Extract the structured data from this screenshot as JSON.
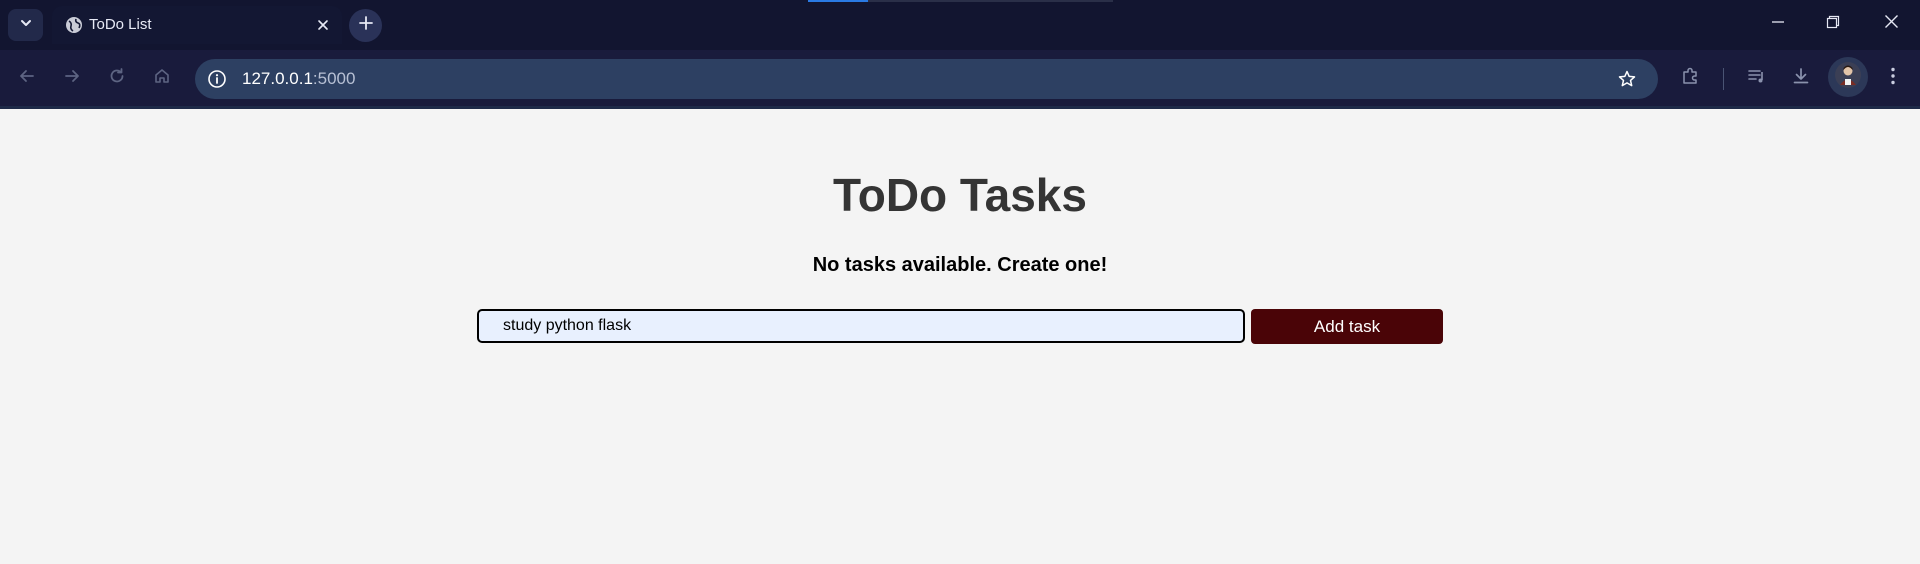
{
  "browser": {
    "tab": {
      "title": "ToDo List",
      "favicon": "globe-icon"
    },
    "address_bar": {
      "host": "127.0.0.1",
      "port": ":5000"
    },
    "icons": {
      "tab_search": "chevron-down-icon",
      "tab_close": "close-icon",
      "new_tab": "plus-icon",
      "back": "arrow-left-icon",
      "forward": "arrow-right-icon",
      "reload": "reload-icon",
      "home": "home-icon",
      "site_info": "info-icon",
      "bookmark": "star-icon",
      "extensions": "puzzle-icon",
      "media": "playlist-icon",
      "downloads": "download-icon",
      "profile": "avatar-icon",
      "menu": "kebab-menu-icon",
      "minimize": "minimize-icon",
      "restore": "restore-icon",
      "close_window": "close-icon"
    }
  },
  "page": {
    "title": "ToDo Tasks",
    "empty_message": "No tasks available. Create one!",
    "task_input": {
      "value": "study python flask",
      "placeholder": ""
    },
    "add_button_label": "Add task"
  },
  "colors": {
    "add_button": "#4a0407",
    "input_background": "#e8f0fe",
    "page_background": "#f4f4f4",
    "title_text": "#343434"
  }
}
